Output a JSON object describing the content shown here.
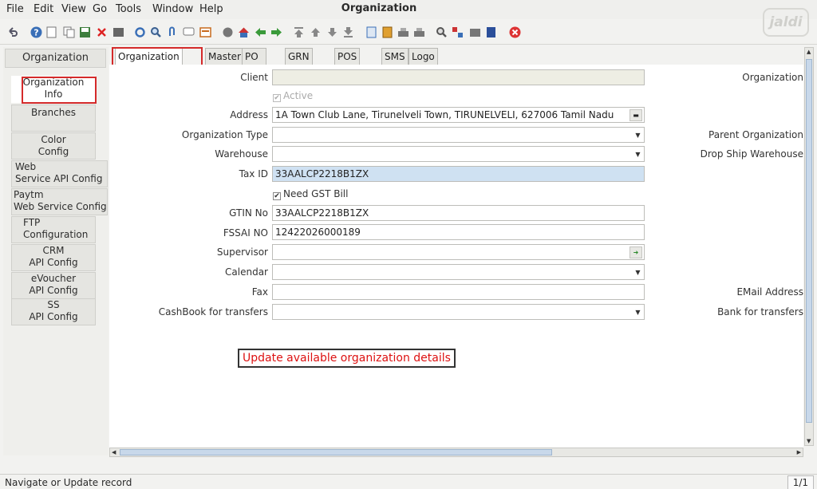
{
  "menubar": {
    "items": [
      "File",
      "Edit",
      "View",
      "Go",
      "Tools",
      "Window",
      "Help"
    ],
    "title": "Organization"
  },
  "toolbar": {
    "icons": [
      "undo-icon",
      "help-icon",
      "new-icon",
      "copy-icon",
      "save-icon",
      "delete-icon",
      "print-preview-icon",
      "refresh-icon",
      "find-icon",
      "attachment-icon",
      "chat-icon",
      "report-icon",
      "archive-icon",
      "home-icon",
      "back-icon",
      "forward-icon",
      "first-record-icon",
      "previous-record-icon",
      "next-record-icon",
      "last-record-icon",
      "detail-icon",
      "workflow-icon",
      "print-icon",
      "print-all-icon",
      "zoom-across-icon",
      "product-info-icon",
      "lock-icon",
      "end-icon",
      "close-icon"
    ]
  },
  "logo": {
    "text": "jaldi"
  },
  "left_tabs": [
    {
      "label": "Organization"
    },
    {
      "label": "Organization\nInfo"
    },
    {
      "label": "Branches"
    },
    {
      "label": "Color\nConfig"
    },
    {
      "label": "Web\nService API Config"
    },
    {
      "label": "Paytm\nWeb Service Config"
    },
    {
      "label": "FTP\nConfiguration"
    },
    {
      "label": "CRM\nAPI Config"
    },
    {
      "label": "eVoucher\nAPI Config"
    },
    {
      "label": "SS\nAPI Config"
    }
  ],
  "tabs": [
    "Organization Info",
    "Master",
    "PO Info",
    "GRN Info",
    "POS Info",
    "SMS",
    "Logo"
  ],
  "form": {
    "client_label": "Client",
    "client_value": "",
    "active_label": "Active",
    "address_label": "Address",
    "address_value": "1A Town Club Lane, Tirunelveli Town, TIRUNELVELI,  627006 Tamil Nadu",
    "org_type_label": "Organization Type",
    "org_type_value": "",
    "warehouse_label": "Warehouse",
    "warehouse_value": "",
    "tax_id_label": "Tax ID",
    "tax_id_value": "33AALCP2218B1ZX",
    "need_gst_label": "Need GST Bill",
    "gtin_label": "GTIN No",
    "gtin_value": "33AALCP2218B1ZX",
    "fssai_label": "FSSAI NO",
    "fssai_value": "12422026000189",
    "supervisor_label": "Supervisor",
    "supervisor_value": "",
    "calendar_label": "Calendar",
    "calendar_value": "",
    "fax_label": "Fax",
    "fax_value": "",
    "cashbook_label": "CashBook for transfers",
    "cashbook_value": "",
    "right_org_label": "Organization",
    "parent_org_label": "Parent Organization",
    "dropship_label": "Drop Ship Warehouse",
    "email_label": "EMail Address",
    "bank_label": "Bank for transfers"
  },
  "annotation": "Update available organization details",
  "status": {
    "text": "Navigate or Update record",
    "record": "1/1"
  }
}
